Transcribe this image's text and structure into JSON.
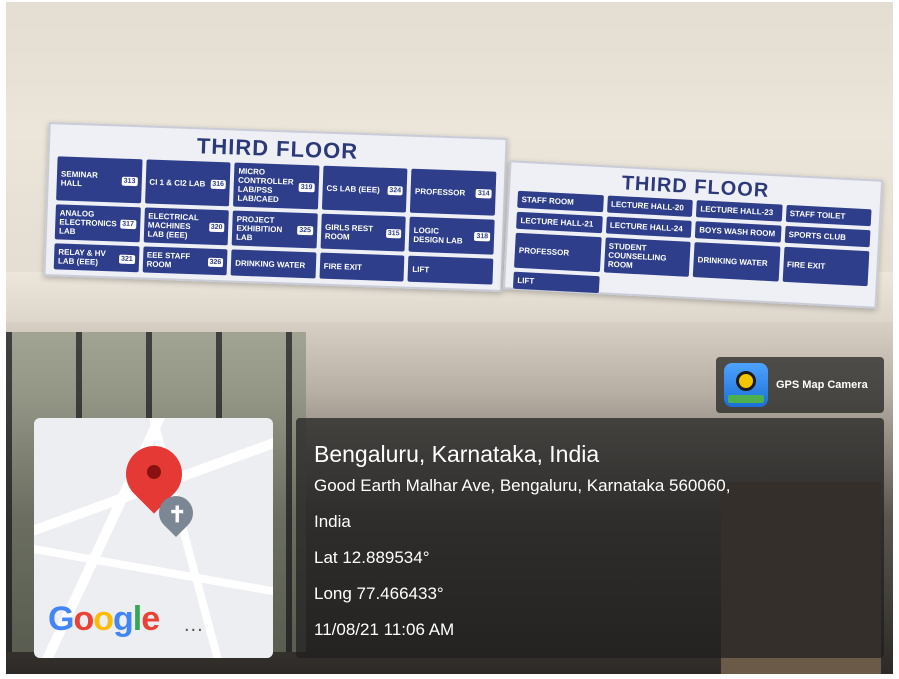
{
  "sign_left": {
    "title": "THIRD FLOOR",
    "cells": [
      {
        "label": "SEMINAR HALL",
        "num": "313"
      },
      {
        "label": "CI 1 & CI2 LAB",
        "num": "316"
      },
      {
        "label": "MICRO CONTROLLER LAB/PSS LAB/CAED",
        "num": "319"
      },
      {
        "label": "CS LAB (EEE)",
        "num": "324"
      },
      {
        "label": "PROFESSOR",
        "num": "314"
      },
      {
        "label": "ANALOG ELECTRONICS LAB",
        "num": "317"
      },
      {
        "label": "ELECTRICAL MACHINES LAB (EEE)",
        "num": "320"
      },
      {
        "label": "PROJECT EXHIBITION LAB",
        "num": "325"
      },
      {
        "label": "GIRLS REST ROOM",
        "num": "315"
      },
      {
        "label": "LOGIC DESIGN LAB",
        "num": "318"
      },
      {
        "label": "RELAY & HV LAB (EEE)",
        "num": "321"
      },
      {
        "label": "EEE STAFF ROOM",
        "num": "326"
      }
    ],
    "side": [
      "DRINKING WATER",
      "FIRE EXIT",
      "LIFT"
    ]
  },
  "sign_right": {
    "title": "THIRD FLOOR",
    "cells": [
      {
        "label": "STAFF ROOM",
        "num": ""
      },
      {
        "label": "LECTURE HALL-20",
        "num": ""
      },
      {
        "label": "LECTURE HALL-23",
        "num": ""
      },
      {
        "label": "STAFF TOILET",
        "num": ""
      },
      {
        "label": "LECTURE HALL-21",
        "num": ""
      },
      {
        "label": "LECTURE HALL-24",
        "num": ""
      },
      {
        "label": "BOYS WASH ROOM",
        "num": ""
      },
      {
        "label": "SPORTS CLUB",
        "num": ""
      },
      {
        "label": "PROFESSOR",
        "num": ""
      },
      {
        "label": "STUDENT COUNSELLING ROOM",
        "num": ""
      },
      {
        "label": "DRINKING WATER",
        "num": ""
      },
      {
        "label": "FIRE EXIT",
        "num": ""
      },
      {
        "label": "LIFT",
        "num": ""
      }
    ]
  },
  "badge": {
    "label": "GPS Map Camera",
    "icon": "gps-map-camera-icon"
  },
  "location": {
    "title": "Bengaluru, Karnataka, India",
    "address_line1": "Good Earth Malhar Ave, Bengaluru, Karnataka 560060,",
    "address_line2": "India",
    "lat": "Lat 12.889534°",
    "long": "Long 77.466433°",
    "datetime": "11/08/21 11:06 AM"
  },
  "map": {
    "logo_letters": [
      "G",
      "o",
      "o",
      "g",
      "l",
      "e"
    ],
    "more": "...",
    "pin_color": "#e53935",
    "poi_icon": "church-icon"
  }
}
